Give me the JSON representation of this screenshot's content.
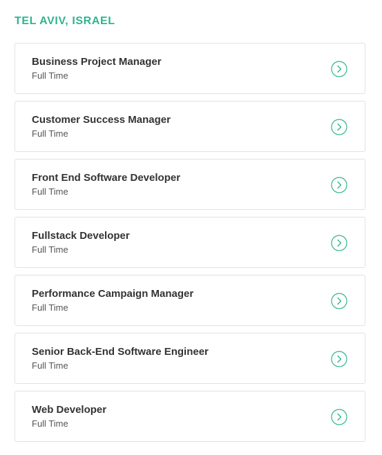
{
  "colors": {
    "accent": "#2fb58d",
    "title": "#333333",
    "subtitle": "#555555",
    "border": "#e1e1e1"
  },
  "location": "TEL AVIV, ISRAEL",
  "jobs": [
    {
      "title": "Business Project Manager",
      "type": "Full Time",
      "icon": "chevron-right-circle-icon"
    },
    {
      "title": "Customer Success Manager",
      "type": "Full Time",
      "icon": "chevron-right-circle-icon"
    },
    {
      "title": "Front End Software Developer",
      "type": "Full Time",
      "icon": "chevron-right-circle-icon"
    },
    {
      "title": "Fullstack Developer",
      "type": "Full Time",
      "icon": "chevron-right-circle-icon"
    },
    {
      "title": "Performance Campaign Manager",
      "type": "Full Time",
      "icon": "chevron-right-circle-icon"
    },
    {
      "title": "Senior Back-End Software Engineer",
      "type": "Full Time",
      "icon": "chevron-right-circle-icon"
    },
    {
      "title": "Web Developer",
      "type": "Full Time",
      "icon": "chevron-right-circle-icon"
    }
  ]
}
